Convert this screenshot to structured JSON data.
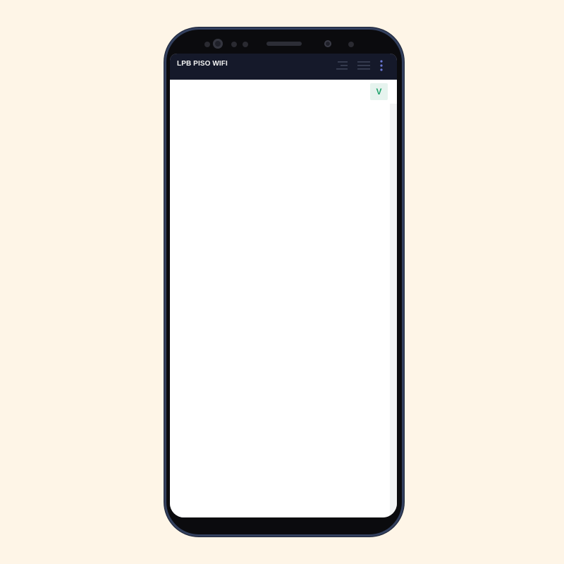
{
  "app_bar": {
    "title": "LPB PISO WIFI",
    "icons": [
      "filter-lines-icon",
      "menu-lines-icon",
      "more-vertical-icon"
    ]
  },
  "sub_bar": {
    "badge_label": "V"
  },
  "colors": {
    "background": "#FEF5E7",
    "app_bar": "#15192a",
    "badge_bg": "#e6f3ee",
    "badge_text": "#1ea36b"
  }
}
